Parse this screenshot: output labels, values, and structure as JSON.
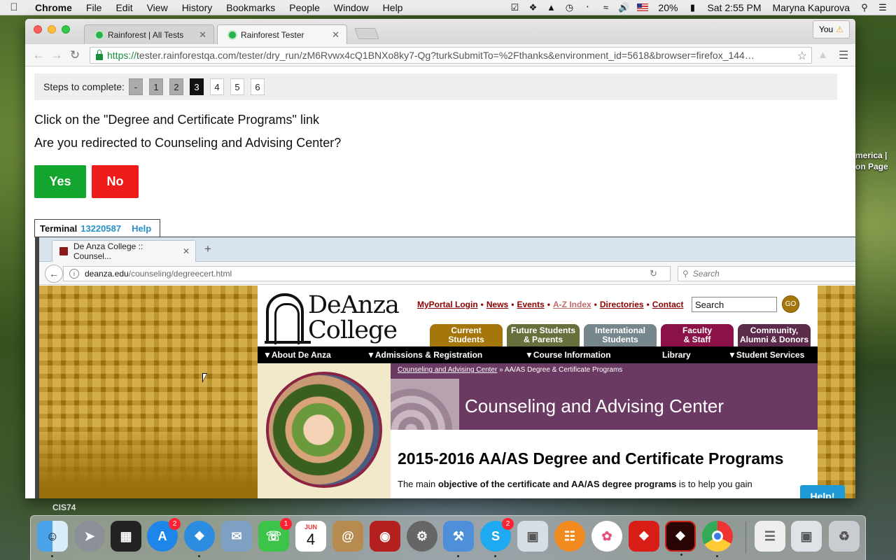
{
  "menubar": {
    "app": "Chrome",
    "items": [
      "File",
      "Edit",
      "View",
      "History",
      "Bookmarks",
      "People",
      "Window",
      "Help"
    ],
    "battery": "20%",
    "clock": "Sat 2:55 PM",
    "user": "Maryna Kapurova"
  },
  "browser": {
    "tabs": [
      {
        "title": "Rainforest | All Tests"
      },
      {
        "title": "Rainforest Tester"
      }
    ],
    "profile": "You",
    "url_scheme": "https://",
    "url_rest": "tester.rainforestqa.com/tester/dry_run/zM6Rvwx4cQ1BNXo8ky7-Qg?turkSubmitTo=%2Fthanks&environment_id=5618&browser=firefox_144…"
  },
  "tester": {
    "steps_label": "Steps to complete:",
    "steps": [
      "-",
      "1",
      "2",
      "3",
      "4",
      "5",
      "6"
    ],
    "current_step": "3",
    "instruction": "Click on the \"Degree and Certificate Programs\" link",
    "question": "Are you redirected to Counseling and Advising Center?",
    "yes_label": "Yes",
    "no_label": "No",
    "terminal_label": "Terminal",
    "terminal_id": "13220587",
    "terminal_help": "Help",
    "help_button": "Help!"
  },
  "firefox": {
    "tab_title": "De Anza College :: Counsel...",
    "url_domain": "deanza.edu",
    "url_path": "/counseling/degreecert.html",
    "search_placeholder": "Search"
  },
  "deanza": {
    "logo_line1": "DeAnza",
    "logo_line2": "College",
    "top_links": [
      "MyPortal Login",
      "News",
      "Events",
      "A-Z Index",
      "Directories",
      "Contact"
    ],
    "search_value": "Search",
    "go_label": "GO",
    "audiences": [
      {
        "line1": "Current",
        "line2": "Students"
      },
      {
        "line1": "Future Students",
        "line2": "& Parents"
      },
      {
        "line1": "International",
        "line2": "Students"
      },
      {
        "line1": "Faculty",
        "line2": "& Staff"
      },
      {
        "line1": "Community,",
        "line2": "Alumni & Donors"
      }
    ],
    "nav": [
      "▼About De Anza",
      "▼Admissions & Registration",
      "▼Course Information",
      "Library",
      "▼Student Services"
    ],
    "breadcrumb_link": "Counseling and Advising Center",
    "breadcrumb_rest": " » AA/AS Degree & Certificate Programs",
    "center_title": "Counseling and Advising Center",
    "heading": "2015-2016 AA/AS Degree and Certificate Programs",
    "body_pre": "The main ",
    "body_bold": "objective of the certificate and AA/AS degree programs",
    "body_post": " is to help you gain"
  },
  "desktop": {
    "label_line1": "merica |",
    "label_line2": "on Page",
    "cis": "CIS74"
  },
  "dock": {
    "badges": {
      "appstore": "2",
      "facetime": "1",
      "skype": "2"
    },
    "calendar_month": "JUN",
    "calendar_day": "4"
  }
}
